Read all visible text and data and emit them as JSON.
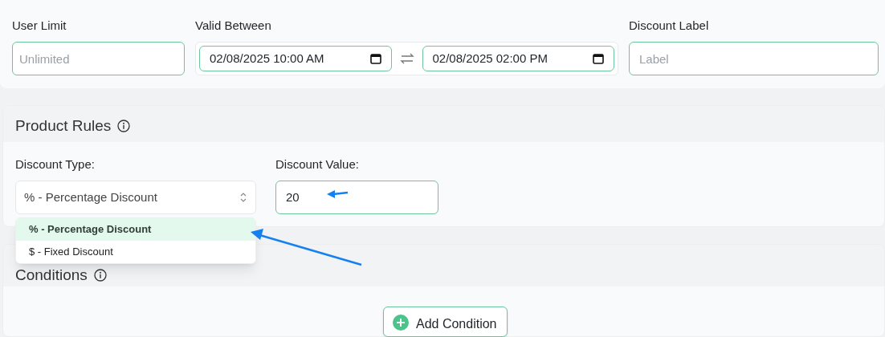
{
  "top_fields": {
    "user_limit": {
      "label": "User Limit",
      "placeholder": "Unlimited"
    },
    "valid_between": {
      "label": "Valid Between",
      "start": "02/08/2025 10:00 AM",
      "end": "02/08/2025 02:00 PM"
    },
    "discount_label": {
      "label": "Discount Label",
      "placeholder": "Label"
    }
  },
  "product_rules": {
    "title": "Product Rules",
    "discount_type": {
      "label": "Discount Type:",
      "value": "% - Percentage Discount",
      "expanded": true,
      "options": [
        {
          "label": "% - Percentage Discount",
          "selected": true
        },
        {
          "label": "$ - Fixed Discount",
          "selected": false
        }
      ]
    },
    "discount_value": {
      "label": "Discount Value:",
      "value": "20"
    }
  },
  "conditions": {
    "title": "Conditions",
    "add_button": "Add Condition"
  }
}
